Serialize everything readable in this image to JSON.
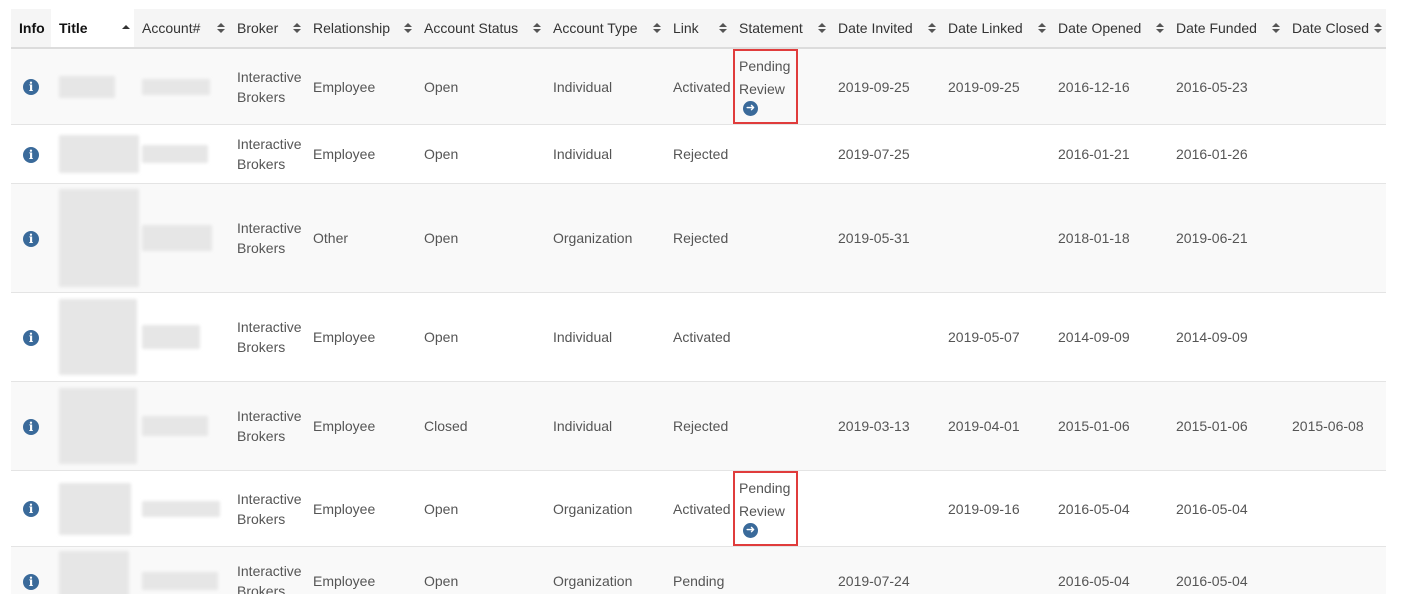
{
  "columns": [
    {
      "label": "Info",
      "sortable": false,
      "sort": "none"
    },
    {
      "label": "Title",
      "sortable": true,
      "sort": "asc"
    },
    {
      "label": "Account#",
      "sortable": true,
      "sort": "none"
    },
    {
      "label": "Broker",
      "sortable": true,
      "sort": "none"
    },
    {
      "label": "Relationship",
      "sortable": true,
      "sort": "none"
    },
    {
      "label": "Account Status",
      "sortable": true,
      "sort": "none"
    },
    {
      "label": "Account Type",
      "sortable": true,
      "sort": "none"
    },
    {
      "label": "Link",
      "sortable": true,
      "sort": "none"
    },
    {
      "label": "Statement",
      "sortable": true,
      "sort": "none"
    },
    {
      "label": "Date Invited",
      "sortable": true,
      "sort": "none"
    },
    {
      "label": "Date Linked",
      "sortable": true,
      "sort": "none"
    },
    {
      "label": "Date Opened",
      "sortable": true,
      "sort": "none"
    },
    {
      "label": "Date Funded",
      "sortable": true,
      "sort": "none"
    },
    {
      "label": "Date Closed",
      "sortable": true,
      "sort": "none"
    }
  ],
  "rows": [
    {
      "broker": "Interactive Brokers",
      "relationship": "Employee",
      "status": "Open",
      "type": "Individual",
      "link": "Activated",
      "statement": "Pending Review",
      "invited": "2019-09-25",
      "linked": "2019-09-25",
      "opened": "2016-12-16",
      "funded": "2016-05-23",
      "closed": ""
    },
    {
      "broker": "Interactive Brokers",
      "relationship": "Employee",
      "status": "Open",
      "type": "Individual",
      "link": "Rejected",
      "statement": "",
      "invited": "2019-07-25",
      "linked": "",
      "opened": "2016-01-21",
      "funded": "2016-01-26",
      "closed": ""
    },
    {
      "broker": "Interactive Brokers",
      "relationship": "Other",
      "status": "Open",
      "type": "Organization",
      "link": "Rejected",
      "statement": "",
      "invited": "2019-05-31",
      "linked": "",
      "opened": "2018-01-18",
      "funded": "2019-06-21",
      "closed": ""
    },
    {
      "broker": "Interactive Brokers",
      "relationship": "Employee",
      "status": "Open",
      "type": "Individual",
      "link": "Activated",
      "statement": "",
      "invited": "",
      "linked": "2019-05-07",
      "opened": "2014-09-09",
      "funded": "2014-09-09",
      "closed": ""
    },
    {
      "broker": "Interactive Brokers",
      "relationship": "Employee",
      "status": "Closed",
      "type": "Individual",
      "link": "Rejected",
      "statement": "",
      "invited": "2019-03-13",
      "linked": "2019-04-01",
      "opened": "2015-01-06",
      "funded": "2015-01-06",
      "closed": "2015-06-08"
    },
    {
      "broker": "Interactive Brokers",
      "relationship": "Employee",
      "status": "Open",
      "type": "Organization",
      "link": "Activated",
      "statement": "Pending Review",
      "invited": "",
      "linked": "2019-09-16",
      "opened": "2016-05-04",
      "funded": "2016-05-04",
      "closed": ""
    },
    {
      "broker": "Interactive Brokers",
      "relationship": "Employee",
      "status": "Open",
      "type": "Organization",
      "link": "Pending",
      "statement": "",
      "invited": "2019-07-24",
      "linked": "",
      "opened": "2016-05-04",
      "funded": "2016-05-04",
      "closed": ""
    }
  ],
  "icons": {
    "info": "info-circle-icon",
    "statement_link": "arrow-circle-right-icon"
  },
  "colors": {
    "accent": "#3a6a9a",
    "highlight_border": "#e03c3c"
  }
}
